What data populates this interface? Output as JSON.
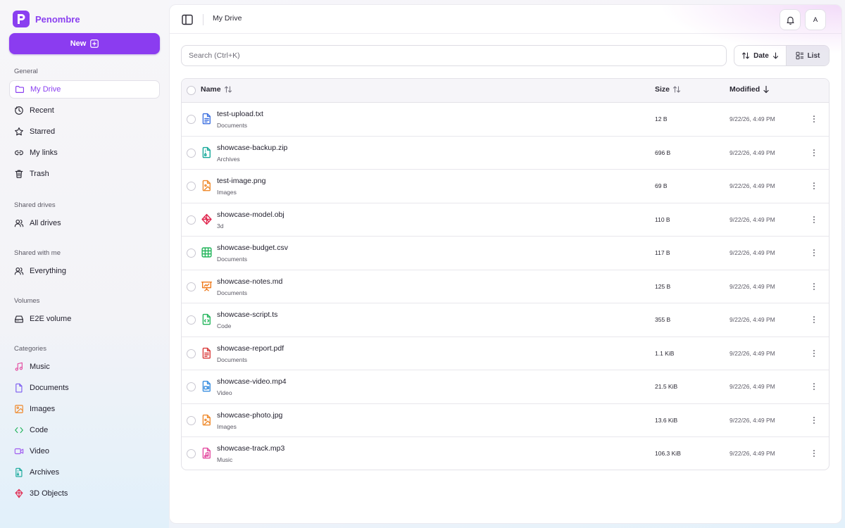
{
  "app": {
    "name": "Penombre",
    "logo_letter": "P",
    "accent": "#8b3cf0"
  },
  "sidebar": {
    "new_label": "New",
    "sections": [
      {
        "title": "General",
        "items": [
          {
            "label": "My Drive",
            "icon": "folder-icon",
            "active": true
          },
          {
            "label": "Recent",
            "icon": "clock-icon"
          },
          {
            "label": "Starred",
            "icon": "star-icon"
          },
          {
            "label": "My links",
            "icon": "link-icon"
          },
          {
            "label": "Trash",
            "icon": "trash-icon"
          }
        ]
      },
      {
        "title": "Shared drives",
        "items": [
          {
            "label": "All drives",
            "icon": "users-icon"
          }
        ]
      },
      {
        "title": "Shared with me",
        "items": [
          {
            "label": "Everything",
            "icon": "users-icon"
          }
        ]
      },
      {
        "title": "Volumes",
        "items": [
          {
            "label": "E2E volume",
            "icon": "hard-drive-icon"
          }
        ]
      },
      {
        "title": "Categories",
        "items": [
          {
            "label": "Music",
            "icon": "music-icon",
            "color": "#e34ba0"
          },
          {
            "label": "Documents",
            "icon": "document-icon",
            "color": "#7b5cf0"
          },
          {
            "label": "Images",
            "icon": "image-icon",
            "color": "#ef8a2c"
          },
          {
            "label": "Code",
            "icon": "code-icon",
            "color": "#22b45a"
          },
          {
            "label": "Video",
            "icon": "video-icon",
            "color": "#a05cf0"
          },
          {
            "label": "Archives",
            "icon": "archive-icon",
            "color": "#14a89a"
          },
          {
            "label": "3D Objects",
            "icon": "cube-icon",
            "color": "#e0284f"
          }
        ]
      }
    ]
  },
  "header": {
    "breadcrumb": "My Drive",
    "avatar_letter": "A"
  },
  "toolbar": {
    "search_placeholder": "Search (Ctrl+K)",
    "sort_label": "Date",
    "view_label": "List"
  },
  "table": {
    "columns": {
      "name": "Name",
      "size": "Size",
      "modified": "Modified"
    },
    "rows": [
      {
        "name": "test-upload.txt",
        "category": "Documents",
        "size": "12 B",
        "modified": "9/22/26, 4:49 PM",
        "icon": "text-file-icon",
        "color": "#3b6fe0"
      },
      {
        "name": "showcase-backup.zip",
        "category": "Archives",
        "size": "696 B",
        "modified": "9/22/26, 4:49 PM",
        "icon": "archive-file-icon",
        "color": "#14a89a"
      },
      {
        "name": "test-image.png",
        "category": "Images",
        "size": "69 B",
        "modified": "9/22/26, 4:49 PM",
        "icon": "image-file-icon",
        "color": "#ef8a2c"
      },
      {
        "name": "showcase-model.obj",
        "category": "3d",
        "size": "110 B",
        "modified": "9/22/26, 4:49 PM",
        "icon": "model-3d-icon",
        "color": "#e0284f"
      },
      {
        "name": "showcase-budget.csv",
        "category": "Documents",
        "size": "117 B",
        "modified": "9/22/26, 4:49 PM",
        "icon": "spreadsheet-icon",
        "color": "#22b45a"
      },
      {
        "name": "showcase-notes.md",
        "category": "Documents",
        "size": "125 B",
        "modified": "9/22/26, 4:49 PM",
        "icon": "presentation-icon",
        "color": "#ef7a1c"
      },
      {
        "name": "showcase-script.ts",
        "category": "Code",
        "size": "355 B",
        "modified": "9/22/26, 4:49 PM",
        "icon": "code-file-icon",
        "color": "#22b45a"
      },
      {
        "name": "showcase-report.pdf",
        "category": "Documents",
        "size": "1.1 KiB",
        "modified": "9/22/26, 4:49 PM",
        "icon": "pdf-file-icon",
        "color": "#d93a3a"
      },
      {
        "name": "showcase-video.mp4",
        "category": "Video",
        "size": "21.5 KiB",
        "modified": "9/22/26, 4:49 PM",
        "icon": "video-file-icon",
        "color": "#3b8fe0"
      },
      {
        "name": "showcase-photo.jpg",
        "category": "Images",
        "size": "13.6 KiB",
        "modified": "9/22/26, 4:49 PM",
        "icon": "image-file-icon",
        "color": "#ef8a2c"
      },
      {
        "name": "showcase-track.mp3",
        "category": "Music",
        "size": "106.3 KiB",
        "modified": "9/22/26, 4:49 PM",
        "icon": "audio-file-icon",
        "color": "#e34ba0"
      }
    ]
  }
}
